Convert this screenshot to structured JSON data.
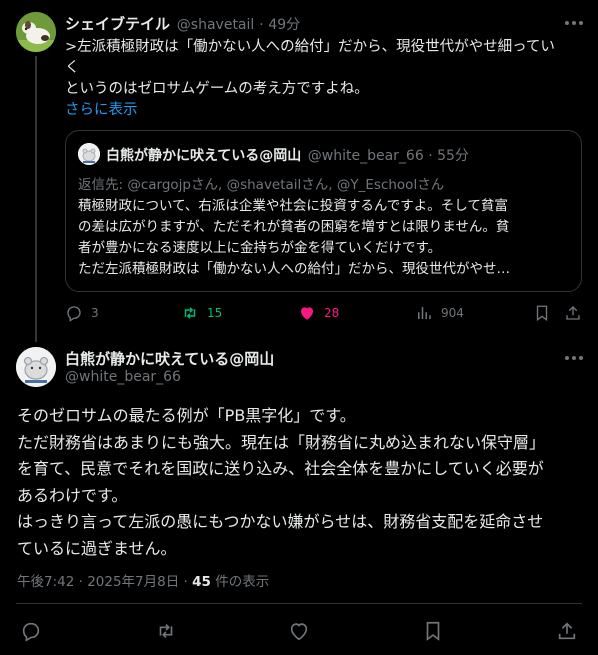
{
  "reply_post": {
    "author_name": "シェイブテイル",
    "handle": "@shavetail",
    "sep": "·",
    "time": "49分",
    "lines": [
      ">左派積極財政は「働かない人への給付」だから、現役世代がやせ細ってい",
      "く",
      "というのはゼロサムゲームの考え方ですよね。"
    ],
    "show_more": "さらに表示",
    "quote": {
      "author_name": "白熊が静かに吠えている@岡山",
      "handle": "@white_bear_66",
      "sep": "·",
      "time": "55分",
      "reply_to": "返信先: @cargojpさん, @shavetailさん, @Y_Eschoolさん",
      "lines": [
        "積極財政について、右派は企業や社会に投資するんですよ。そして貧富",
        "の差は広がりますが、ただそれが貧者の困窮を増すとは限りません。貧",
        "者が豊かになる速度以上に金持ちが金を得ていくだけです。",
        "ただ左派積極財政は「働かない人への給付」だから、現役世代がやせ…"
      ]
    },
    "stats": {
      "replies": "3",
      "reposts": "15",
      "likes": "28",
      "views": "904"
    },
    "colors": {
      "repost": "#00ba7c",
      "like": "#f91880"
    }
  },
  "main_post": {
    "author_name": "白熊が静かに吠えている@岡山",
    "handle": "@white_bear_66",
    "lines": [
      "そのゼロサムの最たる例が「PB黒字化」です。",
      "ただ財務省はあまりにも強大。現在は「財務省に丸め込まれない保守層」",
      "を育て、民意でそれを国政に送り込み、社会全体を豊かにしていく必要が",
      "あるわけです。",
      "はっきり言って左派の愚にもつかない嫌がらせは、財務省支配を延命させ",
      "ているに過ぎません。"
    ],
    "timestamp": "午後7:42 · 2025年7月8日 · ",
    "views_count": "45",
    "views_label": " 件の表示"
  },
  "icons": [
    "more-icon",
    "reply-icon",
    "repost-icon",
    "like-icon",
    "views-icon",
    "bookmark-icon",
    "share-icon"
  ]
}
